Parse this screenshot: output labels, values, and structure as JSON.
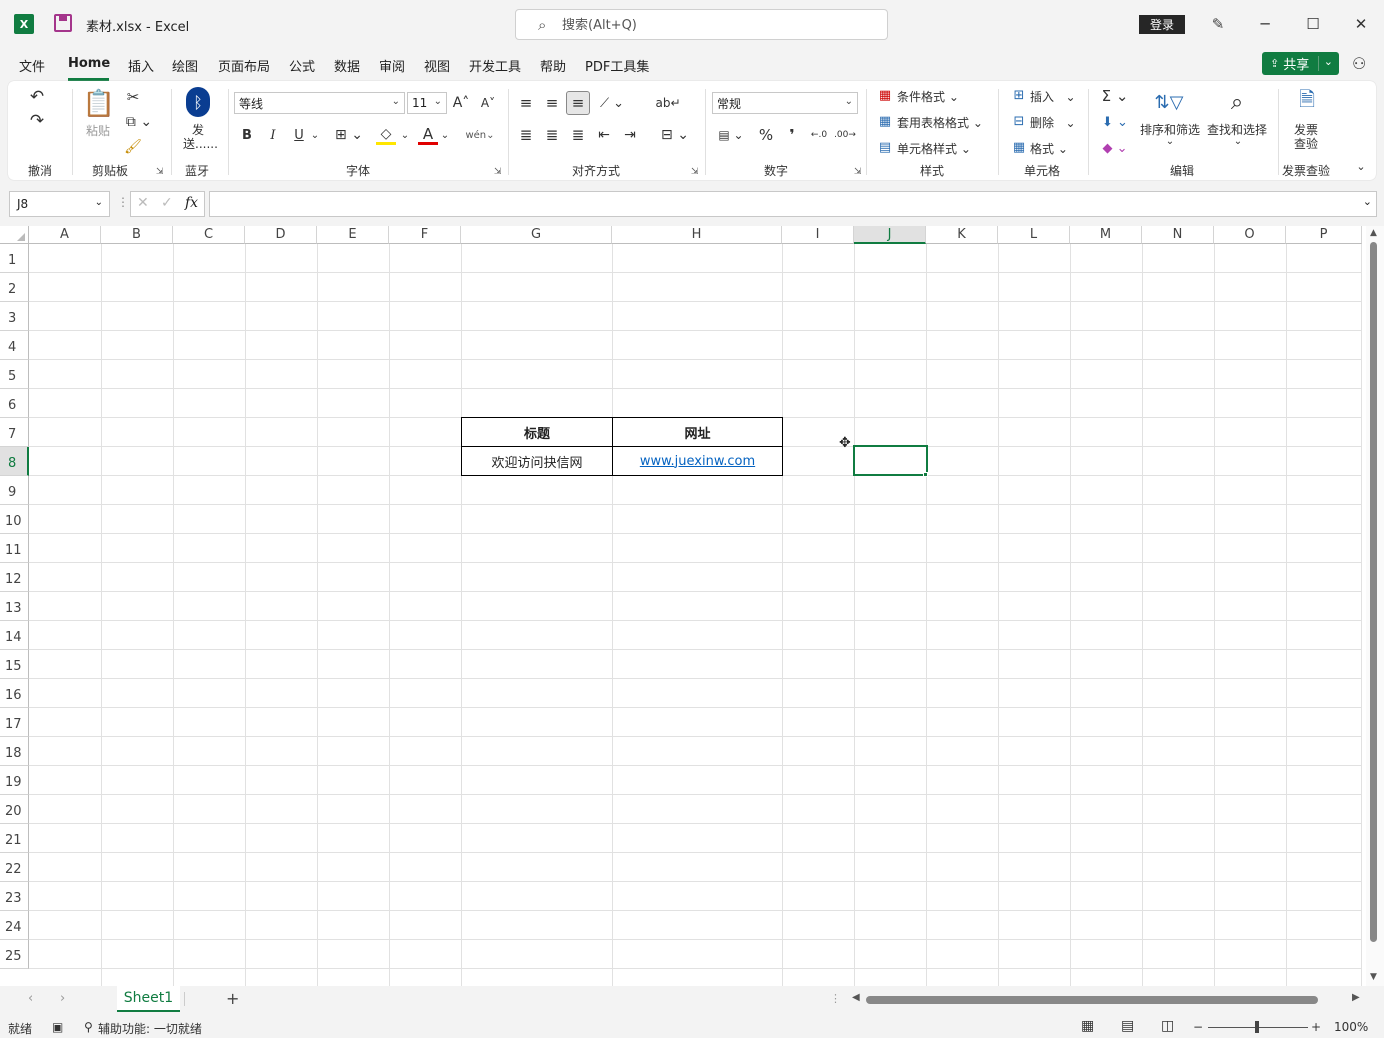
{
  "titlebar": {
    "app_icon_letter": "X",
    "document_title": "素材.xlsx  -  Excel",
    "search_placeholder": "搜索(Alt+Q)",
    "login_label": "登录",
    "minimize": "─",
    "maximize": "☐",
    "close": "✕"
  },
  "menu": {
    "items": [
      "文件",
      "Home",
      "插入",
      "绘图",
      "页面布局",
      "公式",
      "数据",
      "审阅",
      "视图",
      "开发工具",
      "帮助",
      "PDF工具集"
    ],
    "active": "Home",
    "share_label": "共享"
  },
  "ribbon": {
    "groups": {
      "undo": "撤消",
      "clipboard": "剪贴板",
      "bluetooth": "蓝牙",
      "font": "字体",
      "alignment": "对齐方式",
      "number": "数字",
      "styles": "样式",
      "cells": "单元格",
      "editing": "编辑",
      "invoice": "发票查验"
    },
    "paste_label": "粘贴",
    "bluetooth_send_label_1": "发",
    "bluetooth_send_label_2": "送......",
    "font_name": "等线",
    "font_size": "11",
    "number_format": "常规",
    "conditional_format": "条件格式",
    "table_format": "套用表格格式",
    "cell_style": "单元格样式",
    "insert": "插入",
    "delete": "删除",
    "format": "格式",
    "sort_filter": "排序和筛选",
    "find_select": "查找和选择",
    "invoice_check_1": "发票",
    "invoice_check_2": "查验",
    "bold": "B",
    "italic": "I",
    "underline": "U",
    "percent": "%",
    "comma": "❜"
  },
  "formula_bar": {
    "name_box": "J8",
    "fx": "fx",
    "formula": ""
  },
  "grid": {
    "columns": [
      "A",
      "B",
      "C",
      "D",
      "E",
      "F",
      "G",
      "H",
      "I",
      "J",
      "K",
      "L",
      "M",
      "N",
      "O",
      "P"
    ],
    "rows": [
      "1",
      "2",
      "3",
      "4",
      "5",
      "6",
      "7",
      "8",
      "9",
      "10",
      "11",
      "12",
      "13",
      "14",
      "15",
      "16",
      "17",
      "18",
      "19",
      "20",
      "21",
      "22",
      "23",
      "24",
      "25"
    ],
    "selected_column": "J",
    "selected_row": "8",
    "table": {
      "header": [
        "标题",
        "网址"
      ],
      "row": [
        "欢迎访问抉信网",
        "www.juexinw.com"
      ]
    }
  },
  "sheets": {
    "tabs": [
      "Sheet1"
    ],
    "add": "+"
  },
  "status": {
    "ready": "就绪",
    "accessibility": "辅助功能: 一切就绪",
    "zoom": "100%",
    "zoom_minus": "−",
    "zoom_plus": "+"
  },
  "colors": {
    "accent": "#107c41",
    "link": "#0563c1",
    "macro_save": "#a4358b"
  }
}
